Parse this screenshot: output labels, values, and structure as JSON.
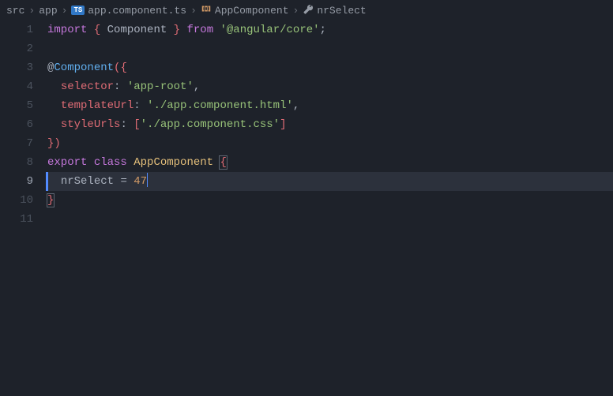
{
  "breadcrumb": {
    "items": [
      {
        "label": "src",
        "icon": null
      },
      {
        "label": "app",
        "icon": null
      },
      {
        "label": "app.component.ts",
        "icon": "ts"
      },
      {
        "label": "AppComponent",
        "icon": "symbol"
      },
      {
        "label": "nrSelect",
        "icon": "wrench"
      }
    ],
    "separator": "›"
  },
  "lineNumbers": [
    "1",
    "2",
    "3",
    "4",
    "5",
    "6",
    "7",
    "8",
    "9",
    "10",
    "11"
  ],
  "activeLine": 9,
  "code": {
    "l1": {
      "import": "import",
      "brace_open": "{",
      "component": "Component",
      "brace_close": "}",
      "from": "from",
      "module": "'@angular/core'",
      "semi": ";"
    },
    "l3": {
      "at": "@",
      "decorator": "Component",
      "paren": "(",
      "brace": "{"
    },
    "l4": {
      "key": "selector",
      "colon": ":",
      "value": "'app-root'",
      "comma": ","
    },
    "l5": {
      "key": "templateUrl",
      "colon": ":",
      "value": "'./app.component.html'",
      "comma": ","
    },
    "l6": {
      "key": "styleUrls",
      "colon": ":",
      "bracket_open": "[",
      "value": "'./app.component.css'",
      "bracket_close": "]"
    },
    "l7": {
      "brace": "}",
      "paren": ")"
    },
    "l8": {
      "export": "export",
      "class_kw": "class",
      "class_name": "AppComponent",
      "brace": "{"
    },
    "l9": {
      "prop": "nrSelect",
      "eq": "=",
      "value": "47"
    },
    "l10": {
      "brace": "}"
    }
  }
}
